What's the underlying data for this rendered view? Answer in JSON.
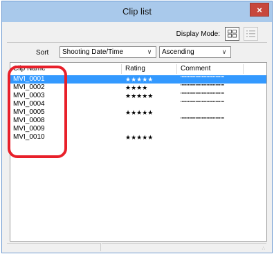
{
  "window": {
    "title": "Clip list",
    "close_glyph": "×"
  },
  "toolbar": {
    "display_mode_label": "Display Mode:",
    "mode_buttons": [
      "grid-view-icon",
      "list-view-icon"
    ]
  },
  "sort": {
    "label": "Sort",
    "field_value": "Shooting Date/Time",
    "order_value": "Ascending",
    "dropdown_glyph": "∨"
  },
  "list": {
    "columns": [
      "Clip Name",
      "Rating",
      "Comment"
    ],
    "rows": [
      {
        "name": "MVI_0001",
        "rating": "★★★★★",
        "comment": "\"\"\"\"\"\"\"\"\"\"\"\"\"\"\"\"\"\"\"\"\"\"\"\"\"\"\"\"",
        "selected": true
      },
      {
        "name": "MVI_0002",
        "rating": "★★★★",
        "comment": "\"\"\"\"\"\"\"\"\"\"\"\"\"\"\"\"\"\"\"\"\"\"\"\"\"\"\"\""
      },
      {
        "name": "MVI_0003",
        "rating": "★★★★★",
        "comment": "\"\"\"\"\"\"\"\"\"\"\"\"\"\"\"\"\"\"\"\"\"\"\"\"\"\"\"\""
      },
      {
        "name": "MVI_0004",
        "rating": "",
        "comment": "\"\"\"\"\"\"\"\"\"\"\"\"\"\"\"\"\"\"\"\"\"\"\"\"\"\"\"\""
      },
      {
        "name": "MVI_0005",
        "rating": "★★★★★",
        "comment": ""
      },
      {
        "name": "MVI_0008",
        "rating": "",
        "comment": "\"\"\"\"\"\"\"\"\"\"\"\"\"\"\"\"\"\"\"\"\"\"\"\"\"\"\"\""
      },
      {
        "name": "MVI_0009",
        "rating": "",
        "comment": ""
      },
      {
        "name": "MVI_0010",
        "rating": "★★★★★",
        "comment": ""
      }
    ]
  },
  "status": {
    "grip_glyph": "∴"
  },
  "colors": {
    "selection": "#3399ff",
    "titlebar": "#a9c9eb",
    "close": "#c7473d",
    "annotation": "#e8202a"
  }
}
